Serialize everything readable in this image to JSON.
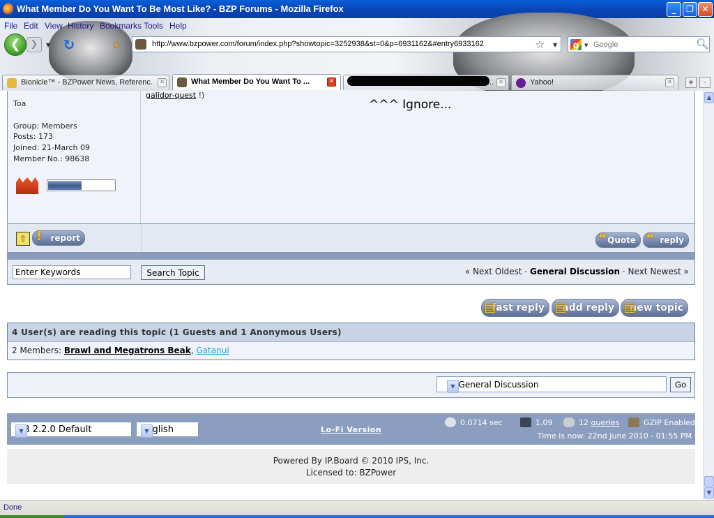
{
  "window": {
    "title": "What Member Do You Want To Be Most Like? - BZP Forums - Mozilla Firefox",
    "min_label": "_",
    "max_label": "❐",
    "close_label": "✕"
  },
  "menu": [
    "File",
    "Edit",
    "View",
    "History",
    "Bookmarks",
    "Tools",
    "Help"
  ],
  "nav": {
    "url": "http://www.bzpower.com/forum/index.php?showtopic=3252938&st=0&p=6931162&#entry6933162",
    "search_placeholder": "Google"
  },
  "tabs": [
    {
      "label": "Bionicle™ - BZPower News, Referenc..."
    },
    {
      "label": "What Member Do You Want To ..."
    },
    {
      "label": "..."
    },
    {
      "label": "Yahoo!"
    }
  ],
  "post": {
    "member_title": "Toa",
    "group": "Group: Members",
    "posts": "Posts: 173",
    "joined": "Joined: 21-March 09",
    "member_no": "Member No.: 98638",
    "reputation_fraction": 0.5,
    "quest_link": "galidor-quest",
    "quest_suffix": " !)",
    "body_text": "^^^ Ignore...",
    "report_label": "report",
    "quote_label": "Quote",
    "reply_label": "reply"
  },
  "search": {
    "keywords_value": "Enter Keywords",
    "button_label": "Search Topic",
    "prev_label": "« Next Oldest",
    "sep": " · ",
    "forum_label": "General Discussion",
    "next_label": "Next Newest »"
  },
  "actions": {
    "fast_reply": "fast reply",
    "add_reply": "add reply",
    "new_topic": "new topic"
  },
  "readers": {
    "header": "4 User(s) are reading this topic (1 Guests and 1 Anonymous Users)",
    "members_label": "2 Members: ",
    "member_1": "Brawl and Megatrons Beak",
    "comma": ", ",
    "member_2": "Gatanui"
  },
  "jump": {
    "selected": "|-- General Discussion",
    "go_label": "Go"
  },
  "footer": {
    "skin": "IPB 2.2.0 Default",
    "language": "English",
    "lofi": "Lo-Fi Version",
    "exec_time": "0.0714 sec",
    "load": "1.09",
    "queries_count": "12 ",
    "queries_link": "queries",
    "gzip": "GZIP Enabled",
    "time_now": "Time is now: 22nd June 2010 - 01:55 PM",
    "powered": "Powered By IP.Board © 2010  IPS, Inc.",
    "licensed": "Licensed to: BZPower"
  },
  "status": {
    "text": "Done"
  }
}
